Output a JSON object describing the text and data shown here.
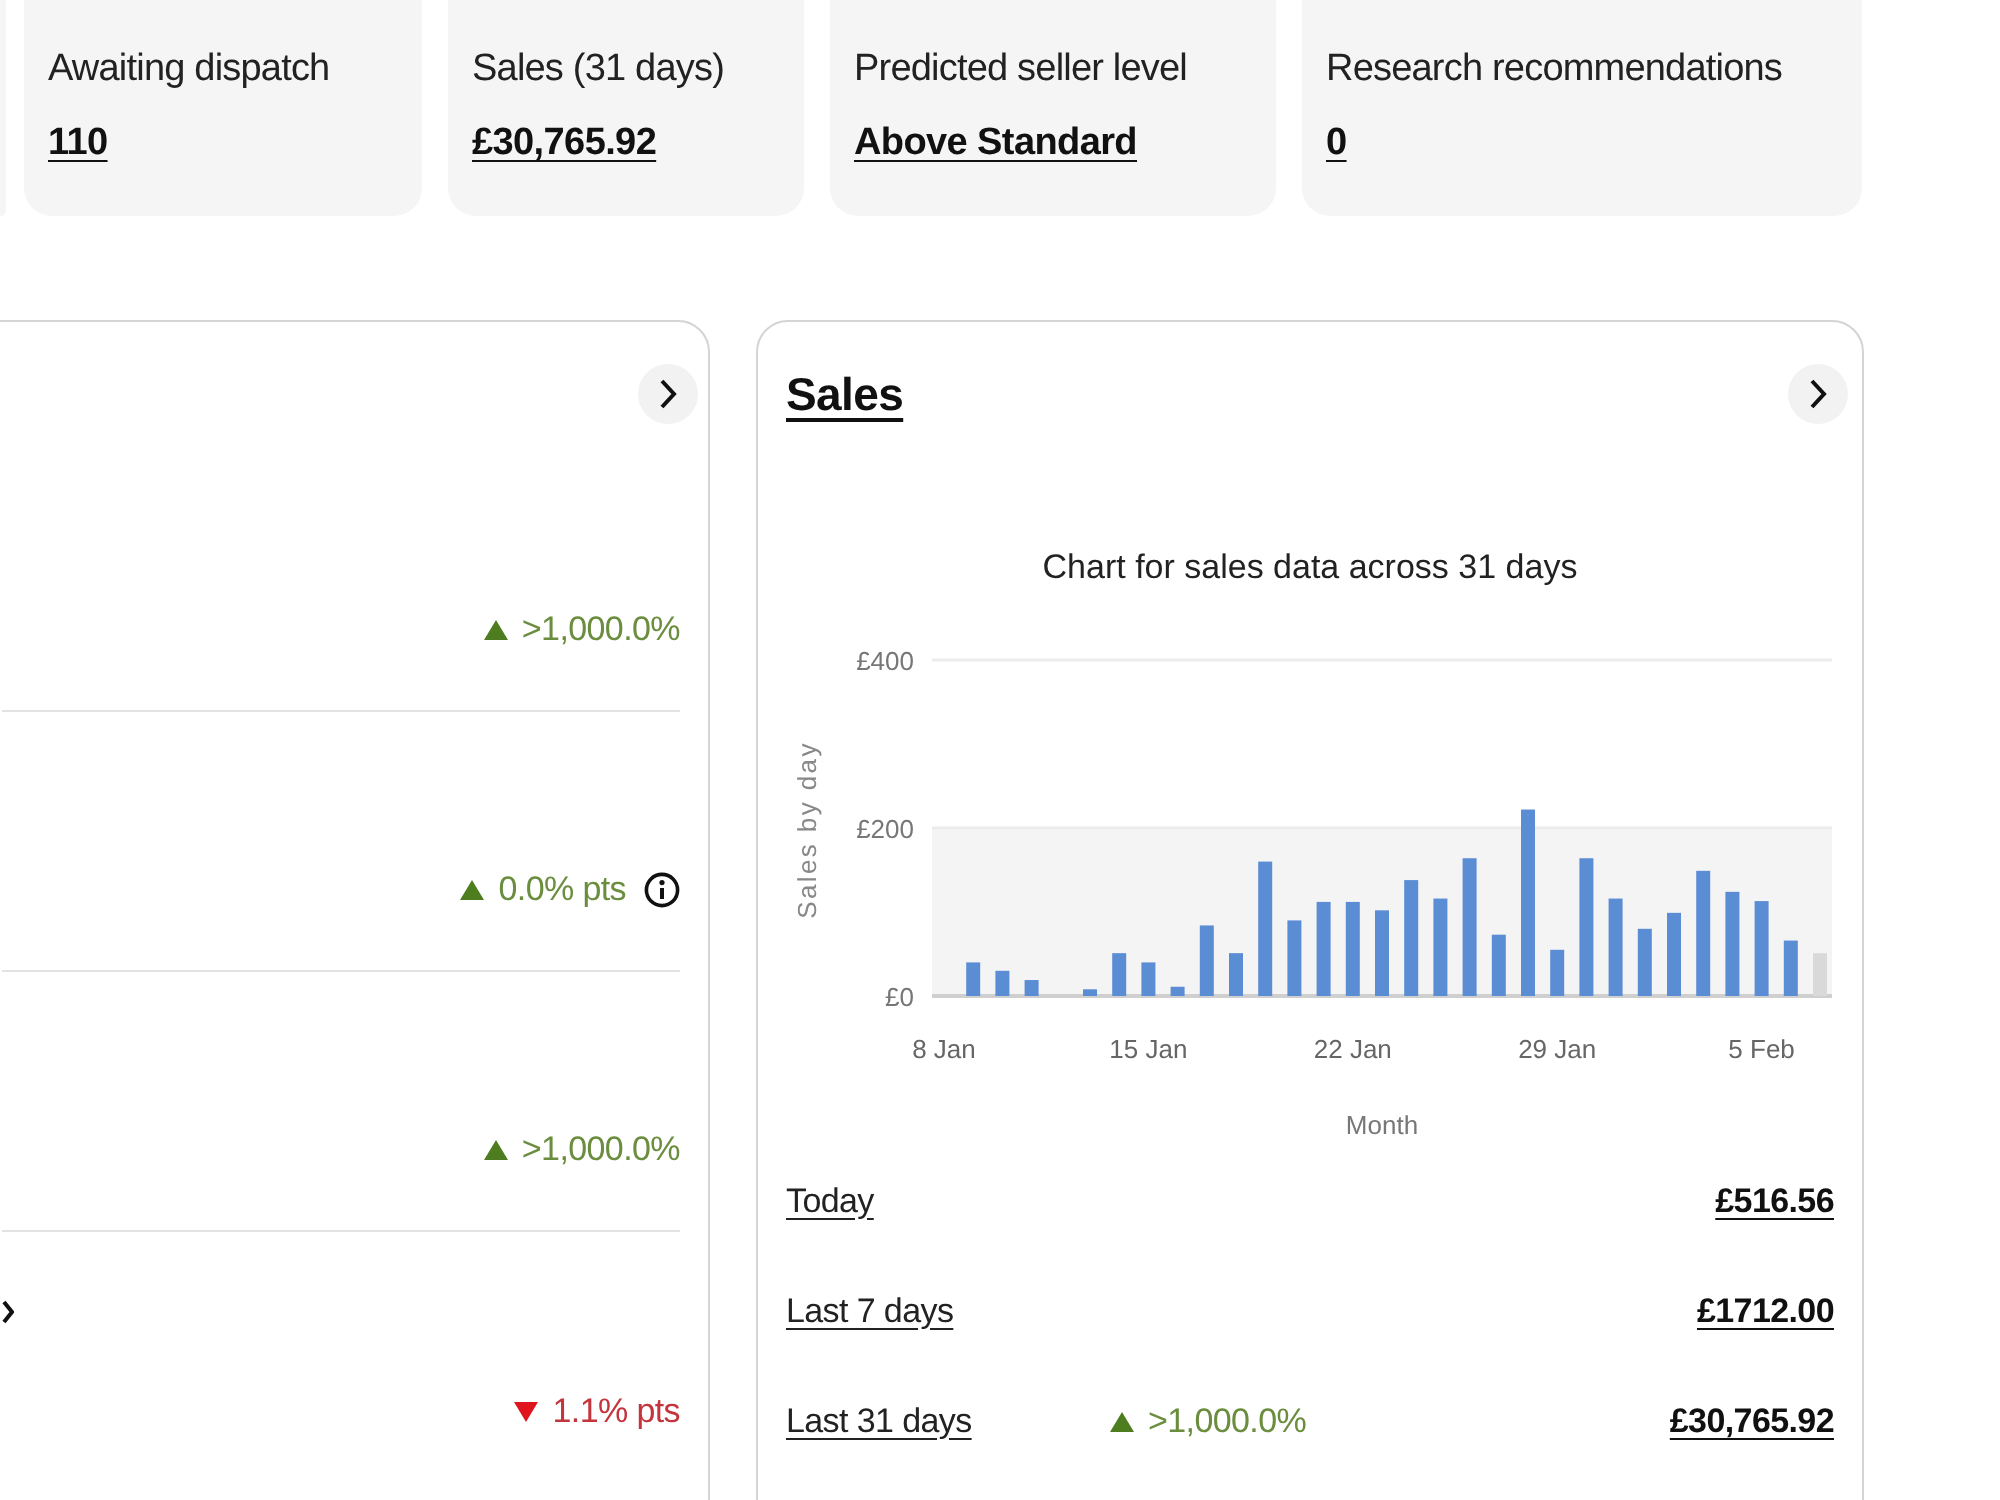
{
  "summary_cards": [
    {
      "label": "Awaiting dispatch",
      "value": "110"
    },
    {
      "label": "Sales (31 days)",
      "value": "£30,765.92"
    },
    {
      "label": "Predicted seller level",
      "value": "Above Standard"
    },
    {
      "label": "Research recommendations",
      "value": "0"
    }
  ],
  "left_panel": {
    "rows": [
      {
        "change": ">1,000.0%",
        "kind": "up",
        "info": false,
        "chevron": false
      },
      {
        "change": "0.0% pts",
        "kind": "up",
        "info": true,
        "chevron": false
      },
      {
        "change": ">1,000.0%",
        "kind": "up",
        "info": false,
        "chevron": false
      },
      {
        "change": "1.1% pts",
        "kind": "down",
        "info": false,
        "chevron": true
      }
    ]
  },
  "sales_panel": {
    "title": "Sales",
    "chart_data": {
      "type": "bar",
      "title": "Chart for sales data across 31 days",
      "xlabel": "Month",
      "ylabel": "Sales by day",
      "categories": [
        "8 Jan",
        null,
        null,
        null,
        null,
        null,
        null,
        "15 Jan",
        null,
        null,
        null,
        null,
        null,
        null,
        "22 Jan",
        null,
        null,
        null,
        null,
        null,
        null,
        "29 Jan",
        null,
        null,
        null,
        null,
        null,
        null,
        "5 Feb",
        null,
        null
      ],
      "ylim": [
        0,
        400
      ],
      "yticks": [
        {
          "value": 0,
          "label": "£0"
        },
        {
          "value": 200,
          "label": "£200"
        },
        {
          "value": 400,
          "label": "£400"
        }
      ],
      "series": [
        {
          "color": "#5b8dd4",
          "values": [
            0,
            40,
            30,
            19,
            0,
            8,
            51,
            40,
            11,
            84,
            51,
            160,
            90,
            112,
            112,
            102,
            138,
            116,
            164,
            73,
            222,
            55,
            164,
            116,
            80,
            99,
            149,
            124,
            113,
            66,
            null
          ]
        },
        {
          "color": "#d9d9d9",
          "values": [
            null,
            null,
            null,
            null,
            null,
            null,
            null,
            null,
            null,
            null,
            null,
            null,
            null,
            null,
            null,
            null,
            null,
            null,
            null,
            null,
            null,
            null,
            null,
            null,
            null,
            null,
            null,
            null,
            null,
            null,
            51
          ]
        }
      ]
    },
    "rows": [
      {
        "label": "Today",
        "value": "£516.56"
      },
      {
        "label": "Last 7 days",
        "value": "£1712.00"
      },
      {
        "label": "Last 31 days",
        "change": ">1,000.0%",
        "kind": "up",
        "value": "£30,765.92"
      }
    ]
  }
}
